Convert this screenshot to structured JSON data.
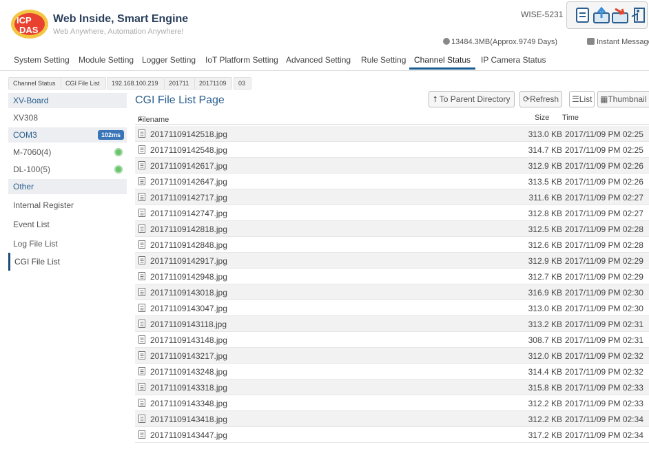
{
  "brand": {
    "title": "Web Inside, Smart Engine",
    "subtitle": "Web Anywhere, Automation Anywhere!",
    "logo_text": "ICP DAS"
  },
  "device": {
    "name": "WISE-5231"
  },
  "status": {
    "storage": "13484.3MB(Approx.9749 Days)",
    "instant_message": "Instant Message"
  },
  "tools": [
    "document-icon",
    "upload-icon",
    "download-icon",
    "logout-icon"
  ],
  "nav": {
    "items": [
      {
        "label": "System Setting"
      },
      {
        "label": "Module Setting"
      },
      {
        "label": "Logger Setting"
      },
      {
        "label": "IoT Platform Setting"
      },
      {
        "label": "Advanced Setting"
      },
      {
        "label": "Rule Setting"
      },
      {
        "label": "Channel Status",
        "active": true
      },
      {
        "label": "IP Camera Status"
      }
    ]
  },
  "breadcrumb": [
    "Channel Status",
    "CGI File List",
    "192.168.100.219",
    "201711",
    "20171109",
    "03"
  ],
  "sidebar": {
    "items": [
      {
        "label": "XV-Board",
        "kind": "header"
      },
      {
        "label": "XV308"
      },
      {
        "label": "COM3",
        "kind": "header",
        "badge": "102ms"
      },
      {
        "label": "M-7060(4)",
        "status": "green"
      },
      {
        "label": "DL-100(5)",
        "status": "green"
      },
      {
        "label": "Other",
        "kind": "header"
      },
      {
        "label": "Internal Register"
      },
      {
        "label": "Event List"
      },
      {
        "label": "Log File List"
      },
      {
        "label": "CGI File List",
        "selected": true
      }
    ]
  },
  "main": {
    "title": "CGI File List Page",
    "buttons": {
      "parent": "To Parent Directory",
      "refresh": "Refresh",
      "list": "List",
      "thumbnail": "Thumbnail"
    },
    "columns": {
      "filename": "Filename",
      "size": "Size",
      "time": "Time"
    },
    "files": [
      {
        "name": "20171109142518.jpg",
        "size": "313.0 KB",
        "time": "2017/11/09 PM 02:25"
      },
      {
        "name": "20171109142548.jpg",
        "size": "314.7 KB",
        "time": "2017/11/09 PM 02:25"
      },
      {
        "name": "20171109142617.jpg",
        "size": "312.9 KB",
        "time": "2017/11/09 PM 02:26"
      },
      {
        "name": "20171109142647.jpg",
        "size": "313.5 KB",
        "time": "2017/11/09 PM 02:26"
      },
      {
        "name": "20171109142717.jpg",
        "size": "311.6 KB",
        "time": "2017/11/09 PM 02:27"
      },
      {
        "name": "20171109142747.jpg",
        "size": "312.8 KB",
        "time": "2017/11/09 PM 02:27"
      },
      {
        "name": "20171109142818.jpg",
        "size": "312.5 KB",
        "time": "2017/11/09 PM 02:28"
      },
      {
        "name": "20171109142848.jpg",
        "size": "312.6 KB",
        "time": "2017/11/09 PM 02:28"
      },
      {
        "name": "20171109142917.jpg",
        "size": "312.9 KB",
        "time": "2017/11/09 PM 02:29"
      },
      {
        "name": "20171109142948.jpg",
        "size": "312.7 KB",
        "time": "2017/11/09 PM 02:29"
      },
      {
        "name": "20171109143018.jpg",
        "size": "316.9 KB",
        "time": "2017/11/09 PM 02:30"
      },
      {
        "name": "20171109143047.jpg",
        "size": "313.0 KB",
        "time": "2017/11/09 PM 02:30"
      },
      {
        "name": "20171109143118.jpg",
        "size": "313.2 KB",
        "time": "2017/11/09 PM 02:31"
      },
      {
        "name": "20171109143148.jpg",
        "size": "308.7 KB",
        "time": "2017/11/09 PM 02:31"
      },
      {
        "name": "20171109143217.jpg",
        "size": "312.0 KB",
        "time": "2017/11/09 PM 02:32"
      },
      {
        "name": "20171109143248.jpg",
        "size": "314.4 KB",
        "time": "2017/11/09 PM 02:32"
      },
      {
        "name": "20171109143318.jpg",
        "size": "315.8 KB",
        "time": "2017/11/09 PM 02:33"
      },
      {
        "name": "20171109143348.jpg",
        "size": "312.2 KB",
        "time": "2017/11/09 PM 02:33"
      },
      {
        "name": "20171109143418.jpg",
        "size": "312.2 KB",
        "time": "2017/11/09 PM 02:34"
      },
      {
        "name": "20171109143447.jpg",
        "size": "317.2 KB",
        "time": "2017/11/09 PM 02:34"
      }
    ]
  },
  "colors": {
    "accent": "#1a5c8f",
    "title": "#2a5e8e",
    "badge": "#3a75b8",
    "status_green": "#6bc46d"
  }
}
